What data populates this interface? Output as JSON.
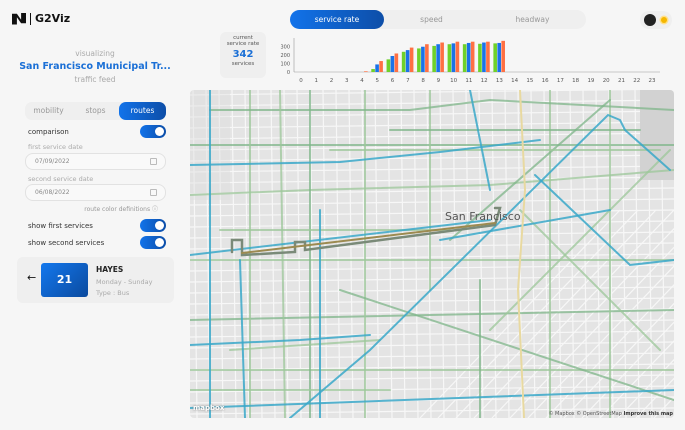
{
  "app": {
    "name": "G2Viz"
  },
  "header": {
    "visualizing": "visualizing",
    "agency": "San Francisco Municipal Tr...",
    "feed": "traffic feed"
  },
  "modes": [
    "mobility",
    "stops",
    "routes"
  ],
  "active_mode": "routes",
  "controls": {
    "comparison": "comparison",
    "comparison_on": true,
    "first_date_label": "first service date",
    "first_date": "07/09/2022",
    "second_date_label": "second service date",
    "second_date": "06/08/2022",
    "route_color_definitions": "route color definitions ⓘ",
    "show_first": "show first services",
    "show_first_on": true,
    "show_second": "show second services",
    "show_second_on": true
  },
  "route_card": {
    "back": "←",
    "number": "21",
    "name": "HAYES",
    "days": "Monday - Sunday",
    "type": "Type : Bus"
  },
  "metric_tabs": [
    "service rate",
    "speed",
    "headway"
  ],
  "active_metric": "service rate",
  "service_rate": {
    "label1": "current",
    "label2": "service rate",
    "value": "342",
    "unit": "services"
  },
  "chart_data": {
    "type": "bar",
    "categories": [
      "0",
      "1",
      "2",
      "3",
      "4",
      "5",
      "6",
      "7",
      "8",
      "9",
      "10",
      "11",
      "12",
      "13",
      "14",
      "15",
      "16",
      "17",
      "18",
      "19",
      "20",
      "21",
      "22",
      "23"
    ],
    "series": [
      {
        "name": "green",
        "color": "#6fd12a",
        "values": [
          0,
          0,
          0,
          0,
          0,
          35,
          150,
          240,
          280,
          310,
          330,
          330,
          335,
          340,
          0,
          0,
          0,
          0,
          0,
          0,
          0,
          0,
          0,
          0
        ]
      },
      {
        "name": "blue",
        "color": "#1a73e8",
        "values": [
          0,
          0,
          0,
          0,
          0,
          90,
          190,
          260,
          300,
          330,
          340,
          345,
          350,
          345,
          0,
          0,
          0,
          0,
          0,
          0,
          0,
          0,
          0,
          0
        ]
      },
      {
        "name": "orange",
        "color": "#ff7043",
        "values": [
          0,
          0,
          0,
          0,
          8,
          130,
          220,
          290,
          330,
          350,
          360,
          360,
          360,
          370,
          0,
          0,
          0,
          0,
          0,
          0,
          0,
          0,
          0,
          0
        ]
      }
    ],
    "yticks": [
      "0",
      "100",
      "200",
      "300"
    ],
    "ylim": [
      0,
      380
    ]
  },
  "map": {
    "city_label": "San Francisco",
    "logo": "mapbox",
    "attribution": "© Mapbox © OpenStreetMap",
    "improve": "Improve this map"
  }
}
